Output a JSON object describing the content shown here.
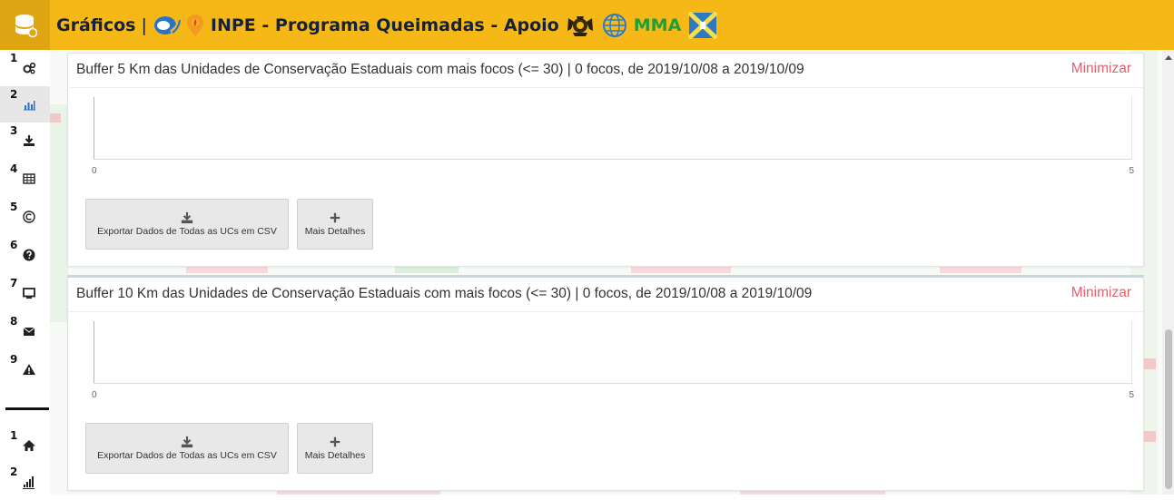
{
  "header": {
    "title": "Gráficos",
    "separator": "|",
    "subtitle": "INPE - Programa Queimadas - Apoio",
    "partner": "MMA",
    "logo_icon": "database-fire-icon",
    "colors": {
      "bar": "#f6b817",
      "title": "#14213f",
      "mma": "#1f9e3a"
    }
  },
  "sidebar": {
    "items": [
      {
        "num": "1",
        "icon": "gears-icon"
      },
      {
        "num": "2",
        "icon": "bar-chart-icon",
        "active": true
      },
      {
        "num": "3",
        "icon": "download-icon"
      },
      {
        "num": "4",
        "icon": "table-icon"
      },
      {
        "num": "5",
        "icon": "copyright-icon"
      },
      {
        "num": "6",
        "icon": "question-circle-icon"
      },
      {
        "num": "7",
        "icon": "monitor-icon"
      },
      {
        "num": "8",
        "icon": "envelope-icon"
      },
      {
        "num": "9",
        "icon": "warning-icon"
      }
    ],
    "bottom_items": [
      {
        "num": "1",
        "icon": "home-icon"
      },
      {
        "num": "2",
        "icon": "signal-bars-icon"
      }
    ]
  },
  "panels": [
    {
      "title": "Buffer 5 Km das Unidades de Conservação Estaduais com mais focos (<= 30) | 0 focos, de 2019/10/08 a 2019/10/09",
      "minimize_label": "Minimizar",
      "export_label": "Exportar Dados de Todas as UCs em CSV",
      "details_label": "Mais Detalhes",
      "chart_data": {
        "type": "bar",
        "categories": [],
        "values": [],
        "xlim": [
          0,
          5
        ],
        "xticks": [
          "0",
          "5"
        ]
      }
    },
    {
      "title": "Buffer 10 Km das Unidades de Conservação Estaduais com mais focos (<= 30) | 0 focos, de 2019/10/08 a 2019/10/09",
      "minimize_label": "Minimizar",
      "export_label": "Exportar Dados de Todas as UCs em CSV",
      "details_label": "Mais Detalhes",
      "chart_data": {
        "type": "bar",
        "categories": [],
        "values": [],
        "xlim": [
          0,
          5
        ],
        "xticks": [
          "0",
          "5"
        ]
      }
    }
  ],
  "colors": {
    "accent_min": "#e4606d"
  }
}
